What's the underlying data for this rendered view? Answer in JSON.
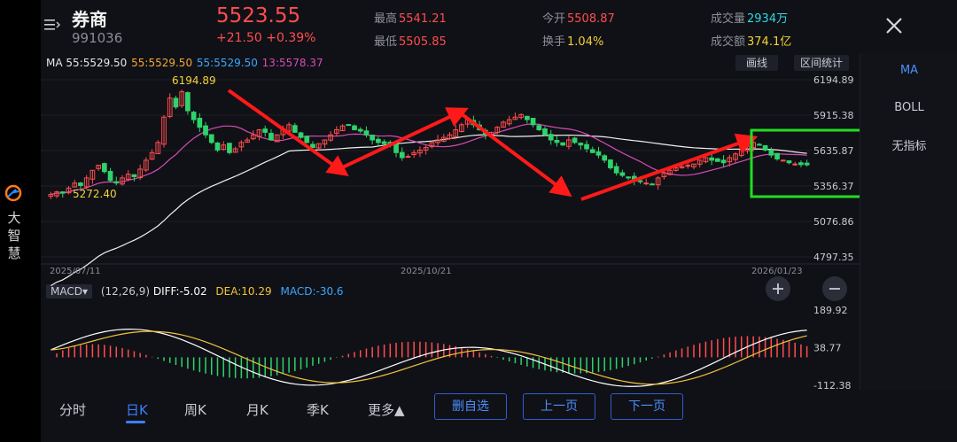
{
  "side": {
    "brand": [
      "大",
      "智",
      "慧"
    ]
  },
  "header": {
    "title": "券商",
    "code": "991036",
    "price": "5523.55",
    "change": "+21.50",
    "change_pct": "+0.39%",
    "high_label": "最高",
    "high": "5541.21",
    "low_label": "最低",
    "low": "5505.85",
    "open_label": "今开",
    "open": "5508.87",
    "turnover_rate_label": "换手",
    "turnover_rate": "1.04%",
    "volume_label": "成交量",
    "volume": "2934万",
    "amount_label": "成交额",
    "amount": "374.1亿"
  },
  "ma": {
    "label": "MA 55:5529.50",
    "ma1": "55:5529.50",
    "ma2": "55:5529.50",
    "ma3": "13:5578.37"
  },
  "toolbar": {
    "draw": "画线",
    "interval": "区间统计"
  },
  "indicators": {
    "ma": "MA",
    "boll": "BOLL",
    "none": "无指标"
  },
  "price_axis": [
    "6194.89",
    "5915.38",
    "5635.87",
    "5356.37",
    "5076.86",
    "4797.35"
  ],
  "annotations": {
    "high": "6194.89",
    "low": "5272.40"
  },
  "dates": [
    "2025/07/11",
    "2025/10/21",
    "2026/01/23"
  ],
  "macd": {
    "selector": "MACD",
    "params": "(12,26,9)",
    "diff": "DIFF:-5.02",
    "dea": "DEA:10.29",
    "macd": "MACD:-30.6",
    "axis": [
      "189.92",
      "38.77",
      "-112.38"
    ]
  },
  "tabs": [
    "分时",
    "日K",
    "周K",
    "月K",
    "季K",
    "更多▲"
  ],
  "buttons": {
    "remove_fav": "删自选",
    "prev_page": "上一页",
    "next_page": "下一页"
  },
  "colors": {
    "up": "#ff4d4f",
    "down": "#2fd36b",
    "ma_white": "#f0f0f0",
    "ma_pink": "#d64bb8",
    "diff": "#ffffff",
    "dea": "#f2c33a",
    "accent": "#3d7fff",
    "highlight_box": "#22dd22",
    "arrow": "#ff1a1a"
  },
  "chart_data": {
    "type": "candlestick",
    "x": [
      "2025/07/11",
      "2025/10/21",
      "2026/01/23"
    ],
    "ylim": [
      4797.35,
      6194.89
    ],
    "y_ticks": [
      6194.89,
      5915.38,
      5635.87,
      5356.37,
      5076.86,
      4797.35
    ],
    "closes": [
      5290,
      5310,
      5300,
      5340,
      5380,
      5360,
      5420,
      5480,
      5520,
      5470,
      5400,
      5380,
      5420,
      5450,
      5430,
      5490,
      5560,
      5620,
      5700,
      5900,
      6050,
      5980,
      6100,
      5950,
      5880,
      5820,
      5760,
      5700,
      5640,
      5680,
      5620,
      5650,
      5700,
      5720,
      5760,
      5800,
      5780,
      5720,
      5760,
      5800,
      5840,
      5780,
      5740,
      5700,
      5660,
      5690,
      5720,
      5760,
      5800,
      5830,
      5840,
      5800,
      5790,
      5760,
      5720,
      5700,
      5690,
      5680,
      5620,
      5580,
      5590,
      5620,
      5640,
      5660,
      5700,
      5720,
      5740,
      5760,
      5800,
      5840,
      5880,
      5840,
      5800,
      5760,
      5780,
      5820,
      5860,
      5880,
      5900,
      5920,
      5880,
      5840,
      5800,
      5760,
      5720,
      5700,
      5680,
      5720,
      5700,
      5680,
      5650,
      5620,
      5600,
      5560,
      5500,
      5460,
      5440,
      5420,
      5400,
      5390,
      5380,
      5370,
      5420,
      5460,
      5480,
      5500,
      5510,
      5520,
      5530,
      5560,
      5580,
      5560,
      5550,
      5540,
      5580,
      5610,
      5640,
      5670,
      5700,
      5680,
      5640,
      5600,
      5570,
      5560,
      5540,
      5530,
      5525,
      5523.55
    ],
    "series": [
      {
        "name": "DIFF",
        "value": -5.02
      },
      {
        "name": "DEA",
        "value": 10.29
      },
      {
        "name": "MACD",
        "value": -30.6
      }
    ],
    "macd_ylim": [
      -112.38,
      189.92
    ]
  }
}
